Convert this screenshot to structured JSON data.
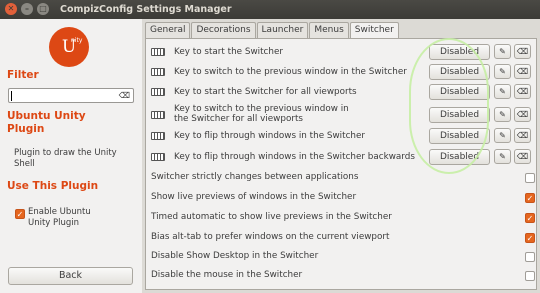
{
  "window": {
    "title": "CompizConfig Settings Manager",
    "close_glyph": "✕",
    "min_glyph": "–",
    "max_glyph": "□"
  },
  "sidebar": {
    "logo_letter": "U",
    "logo_small": "nity",
    "filter_heading": "Filter",
    "filter_value": "",
    "filter_clear": "⌫",
    "plugin_heading_line1": "Ubuntu Unity",
    "plugin_heading_line2": "Plugin",
    "plugin_desc_line1": "Plugin to draw the Unity",
    "plugin_desc_line2": "Shell",
    "use_heading": "Use This Plugin",
    "enable_label_line1": "Enable Ubuntu",
    "enable_label_line2": "Unity Plugin",
    "enable_checked": true,
    "back_label": "Back"
  },
  "tabs": [
    {
      "label": "General",
      "active": false
    },
    {
      "label": "Decorations",
      "active": false
    },
    {
      "label": "Launcher",
      "active": false
    },
    {
      "label": "Menus",
      "active": false
    },
    {
      "label": "Switcher",
      "active": true
    }
  ],
  "keybindings": [
    {
      "line1": "Key to start the Switcher",
      "line2": "",
      "value": "Disabled"
    },
    {
      "line1": "Key to switch to the previous window in the Switcher",
      "line2": "",
      "value": "Disabled"
    },
    {
      "line1": "Key to start the Switcher for all viewports",
      "line2": "",
      "value": "Disabled"
    },
    {
      "line1": "Key to switch to the previous window in",
      "line2": "the Switcher for all viewports",
      "value": "Disabled"
    },
    {
      "line1": "Key to flip through windows in the Switcher",
      "line2": "",
      "value": "Disabled"
    },
    {
      "line1": "Key to flip through windows in the Switcher backwards",
      "line2": "",
      "value": "Disabled"
    }
  ],
  "options": [
    {
      "label": "Switcher strictly changes between applications",
      "checked": false
    },
    {
      "label": "Show live previews of windows in the Switcher",
      "checked": true
    },
    {
      "label": "Timed automatic to show live previews in the Switcher",
      "checked": true
    },
    {
      "label": "Bias alt-tab to prefer windows on the current viewport",
      "checked": true
    },
    {
      "label": "Disable Show Desktop in the Switcher",
      "checked": false
    },
    {
      "label": "Disable the mouse in the Switcher",
      "checked": false
    }
  ],
  "icons": {
    "edit": "✎",
    "clear": "⌫",
    "check": "✓"
  },
  "colors": {
    "accent": "#dd4814",
    "checkbox_on": "#e5661f",
    "highlight": "#c6eea4"
  }
}
